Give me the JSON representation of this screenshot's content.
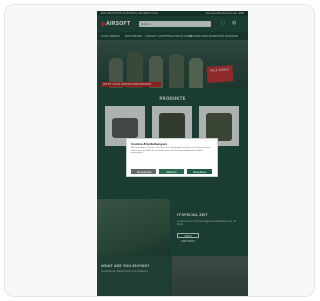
{
  "topbar": {
    "left_text": "DIE GRÖSSTE AUSWAHL AN REPLICAS",
    "right_text": "Versandkostenfrei ab 49€"
  },
  "header": {
    "logo_text": "AIRSOFT",
    "search_placeholder": "Suche…",
    "account_icon": "account-icon",
    "cart_icon": "cart-icon"
  },
  "nav": {
    "items": [
      "SALE WEEKS",
      "NEUHEITEN",
      "AIRSOFT WAFFEN",
      "AUSRÜSTUNG",
      "BEKLEIDUNG",
      "ZUBEHÖR",
      "MARKEN"
    ]
  },
  "hero": {
    "promo_text": "JETZT SALE WEEKS ENTDECKEN",
    "sticker_text": "SALE WEEKS"
  },
  "sections": {
    "products_title": "PRODUKTE"
  },
  "cookie_modal": {
    "title": "Cookie-Einstellungen",
    "text": "Wir verwenden Cookies, um Ihnen den bestmöglichen Service zu bieten. Diese helfen uns, die Website zu verbessern und Ihnen personalisierte Inhalte anzuzeigen.",
    "btn_settings": "Einstellungen",
    "btn_reject": "Ablehnen",
    "btn_accept": "Akzeptieren"
  },
  "feature": {
    "title": "IT-SPECIAL ZEIT",
    "text": "Lorem ipsum Tactical Apparel Kollektion neu im Shop",
    "button": "MEHR ERFAHREN"
  },
  "bottom": {
    "left_title": "WHAT ARE YOU BUYING?",
    "left_text": "Ausrüstung, Bekleidung und Zubehör"
  }
}
